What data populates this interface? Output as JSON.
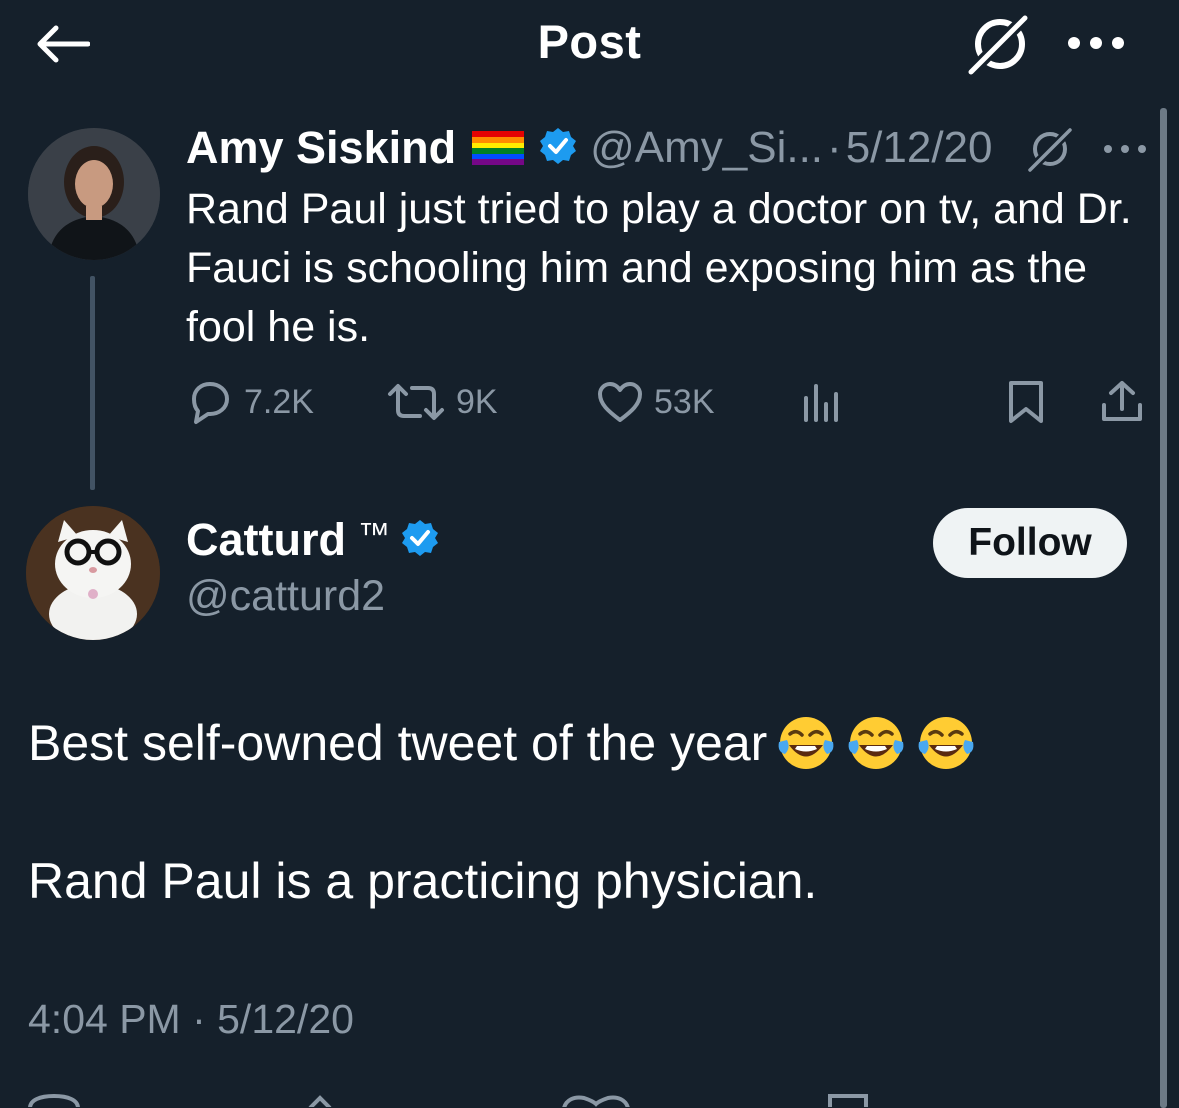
{
  "header": {
    "title": "Post",
    "back_icon": "arrow-left-icon",
    "grok_icon": "grok-icon",
    "more_icon": "more-horizontal-icon"
  },
  "parent_tweet": {
    "author_name": "Amy Siskind",
    "flag_icon": "rainbow-flag-icon",
    "verified_icon": "verified-badge-icon",
    "handle": "@Amy_Si...",
    "separator": "·",
    "date": "5/12/20",
    "text": "Rand Paul just tried to play a doctor on tv, and Dr. Fauci is schooling him and exposing him as the fool he is.",
    "stats": {
      "replies": "7.2K",
      "reposts": "9K",
      "likes": "53K"
    }
  },
  "main_tweet": {
    "author_name": "Catturd",
    "trademark": "™",
    "verified_icon": "verified-badge-icon",
    "handle": "@catturd2",
    "follow_label": "Follow",
    "text_line_1": "Best self-owned tweet of the year",
    "emoji_icon": "face-with-tears-of-joy-icon",
    "text_line_2": "Rand Paul is a practicing physician.",
    "timestamp": "4:04 PM · 5/12/20"
  },
  "colors": {
    "background": "#15202b",
    "text_primary": "#ffffff",
    "text_secondary": "#8b98a5",
    "verified_blue": "#1d9bf0",
    "follow_bg": "#eff3f4",
    "thread_line": "#425364"
  }
}
